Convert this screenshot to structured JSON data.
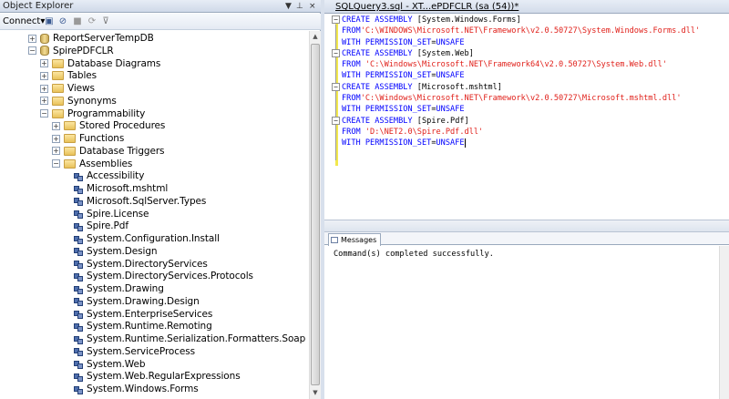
{
  "object_explorer": {
    "title": "Object Explorer",
    "title_buttons": [
      "▼",
      "⊥",
      "×"
    ],
    "toolbar": {
      "connect_label": "Connect",
      "connect_arrow": "▾",
      "icons": [
        "connect-server-icon",
        "disconnect-icon",
        "stop-icon",
        "refresh-icon",
        "filter-icon"
      ]
    },
    "tree": [
      {
        "label": "ReportServerTempDB",
        "indent": 0,
        "expander": "+",
        "icon": "database-icon"
      },
      {
        "label": "SpirePDFCLR",
        "indent": 0,
        "expander": "−",
        "icon": "database-icon"
      },
      {
        "label": "Database Diagrams",
        "indent": 1,
        "expander": "+",
        "icon": "folder-icon"
      },
      {
        "label": "Tables",
        "indent": 1,
        "expander": "+",
        "icon": "folder-icon"
      },
      {
        "label": "Views",
        "indent": 1,
        "expander": "+",
        "icon": "folder-icon"
      },
      {
        "label": "Synonyms",
        "indent": 1,
        "expander": "+",
        "icon": "folder-icon"
      },
      {
        "label": "Programmability",
        "indent": 1,
        "expander": "−",
        "icon": "folder-icon"
      },
      {
        "label": "Stored Procedures",
        "indent": 2,
        "expander": "+",
        "icon": "folder-icon"
      },
      {
        "label": "Functions",
        "indent": 2,
        "expander": "+",
        "icon": "folder-icon"
      },
      {
        "label": "Database Triggers",
        "indent": 2,
        "expander": "+",
        "icon": "folder-icon"
      },
      {
        "label": "Assemblies",
        "indent": 2,
        "expander": "−",
        "icon": "folder-icon"
      },
      {
        "label": "Accessibility",
        "indent": 3,
        "expander": "",
        "icon": "assembly-icon"
      },
      {
        "label": "Microsoft.mshtml",
        "indent": 3,
        "expander": "",
        "icon": "assembly-icon"
      },
      {
        "label": "Microsoft.SqlServer.Types",
        "indent": 3,
        "expander": "",
        "icon": "assembly-icon"
      },
      {
        "label": "Spire.License",
        "indent": 3,
        "expander": "",
        "icon": "assembly-icon"
      },
      {
        "label": "Spire.Pdf",
        "indent": 3,
        "expander": "",
        "icon": "assembly-icon"
      },
      {
        "label": "System.Configuration.Install",
        "indent": 3,
        "expander": "",
        "icon": "assembly-icon"
      },
      {
        "label": "System.Design",
        "indent": 3,
        "expander": "",
        "icon": "assembly-icon"
      },
      {
        "label": "System.DirectoryServices",
        "indent": 3,
        "expander": "",
        "icon": "assembly-icon"
      },
      {
        "label": "System.DirectoryServices.Protocols",
        "indent": 3,
        "expander": "",
        "icon": "assembly-icon"
      },
      {
        "label": "System.Drawing",
        "indent": 3,
        "expander": "",
        "icon": "assembly-icon"
      },
      {
        "label": "System.Drawing.Design",
        "indent": 3,
        "expander": "",
        "icon": "assembly-icon"
      },
      {
        "label": "System.EnterpriseServices",
        "indent": 3,
        "expander": "",
        "icon": "assembly-icon"
      },
      {
        "label": "System.Runtime.Remoting",
        "indent": 3,
        "expander": "",
        "icon": "assembly-icon"
      },
      {
        "label": "System.Runtime.Serialization.Formatters.Soap",
        "indent": 3,
        "expander": "",
        "icon": "assembly-icon"
      },
      {
        "label": "System.ServiceProcess",
        "indent": 3,
        "expander": "",
        "icon": "assembly-icon"
      },
      {
        "label": "System.Web",
        "indent": 3,
        "expander": "",
        "icon": "assembly-icon"
      },
      {
        "label": "System.Web.RegularExpressions",
        "indent": 3,
        "expander": "",
        "icon": "assembly-icon"
      },
      {
        "label": "System.Windows.Forms",
        "indent": 3,
        "expander": "",
        "icon": "assembly-icon"
      }
    ]
  },
  "query_window": {
    "tab_title": "SQLQuery3.sql - XT...ePDFCLR  (sa (54))*",
    "fold_marks": [
      "−",
      "−",
      "−",
      "−"
    ],
    "code_lines": [
      [
        {
          "t": "kw",
          "s": "CREATE ASSEMBLY "
        },
        {
          "t": "plain",
          "s": "[System.Windows.Forms]"
        }
      ],
      [
        {
          "t": "kw",
          "s": "FROM"
        },
        {
          "t": "str",
          "s": "'C:\\WINDOWS\\Microsoft.NET\\Framework\\v2.0.50727\\System.Windows.Forms.dll'"
        }
      ],
      [
        {
          "t": "kw",
          "s": "WITH PERMISSION_SET"
        },
        {
          "t": "plain",
          "s": "="
        },
        {
          "t": "kw",
          "s": "UNSAFE"
        }
      ],
      [
        {
          "t": "kw",
          "s": "CREATE ASSEMBLY "
        },
        {
          "t": "plain",
          "s": "[System.Web]"
        }
      ],
      [
        {
          "t": "kw",
          "s": "FROM "
        },
        {
          "t": "str",
          "s": "'C:\\Windows\\Microsoft.NET\\Framework64\\v2.0.50727\\System.Web.dll'"
        }
      ],
      [
        {
          "t": "kw",
          "s": "WITH PERMISSION_SET"
        },
        {
          "t": "plain",
          "s": "="
        },
        {
          "t": "kw",
          "s": "UNSAFE"
        }
      ],
      [
        {
          "t": "kw",
          "s": "CREATE ASSEMBLY "
        },
        {
          "t": "plain",
          "s": "[Microsoft.mshtml]"
        }
      ],
      [
        {
          "t": "kw",
          "s": "FROM"
        },
        {
          "t": "str",
          "s": "'C:\\Windows\\Microsoft.NET\\Framework\\v2.0.50727\\Microsoft.mshtml.dll'"
        }
      ],
      [
        {
          "t": "kw",
          "s": "WITH PERMISSION_SET"
        },
        {
          "t": "plain",
          "s": "="
        },
        {
          "t": "kw",
          "s": "UNSAFE"
        }
      ],
      [
        {
          "t": "kw",
          "s": "CREATE ASSEMBLY "
        },
        {
          "t": "plain",
          "s": "[Spire.Pdf]"
        }
      ],
      [
        {
          "t": "kw",
          "s": "FROM "
        },
        {
          "t": "str",
          "s": "'D:\\NET2.0\\Spire.Pdf.dll'"
        }
      ],
      [
        {
          "t": "kw",
          "s": "WITH PERMISSION_SET"
        },
        {
          "t": "plain",
          "s": "="
        },
        {
          "t": "kw",
          "s": "UNSAFE"
        }
      ]
    ],
    "colors": {
      "keyword": "#0000ff",
      "string": "#e0201a",
      "change_bar": "#f2e84d"
    }
  },
  "results": {
    "tab_label": "Messages",
    "message": "Command(s) completed successfully."
  }
}
